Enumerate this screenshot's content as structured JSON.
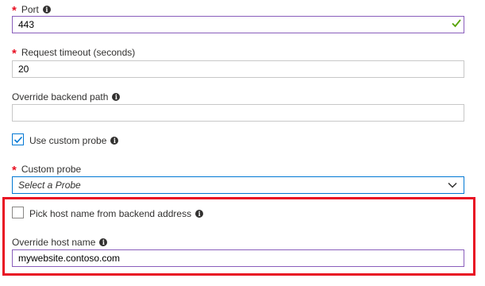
{
  "port": {
    "label": "Port",
    "value": "443"
  },
  "request_timeout": {
    "label": "Request timeout (seconds)",
    "value": "20"
  },
  "override_backend_path": {
    "label": "Override backend path",
    "value": ""
  },
  "use_custom_probe": {
    "label": "Use custom probe",
    "checked": true
  },
  "custom_probe": {
    "label": "Custom probe",
    "selected": "Select a Probe"
  },
  "pick_host_name": {
    "label": "Pick host name from backend address",
    "checked": false
  },
  "override_host_name": {
    "label": "Override host name",
    "value": "mywebsite.contoso.com"
  },
  "required_marker": "*",
  "info_glyph": "i",
  "colors": {
    "required": "#e81123",
    "valid": "#57a300",
    "focus_purple": "#8a5ebc",
    "accent_blue": "#0078d4",
    "highlight_border": "#e81123"
  }
}
